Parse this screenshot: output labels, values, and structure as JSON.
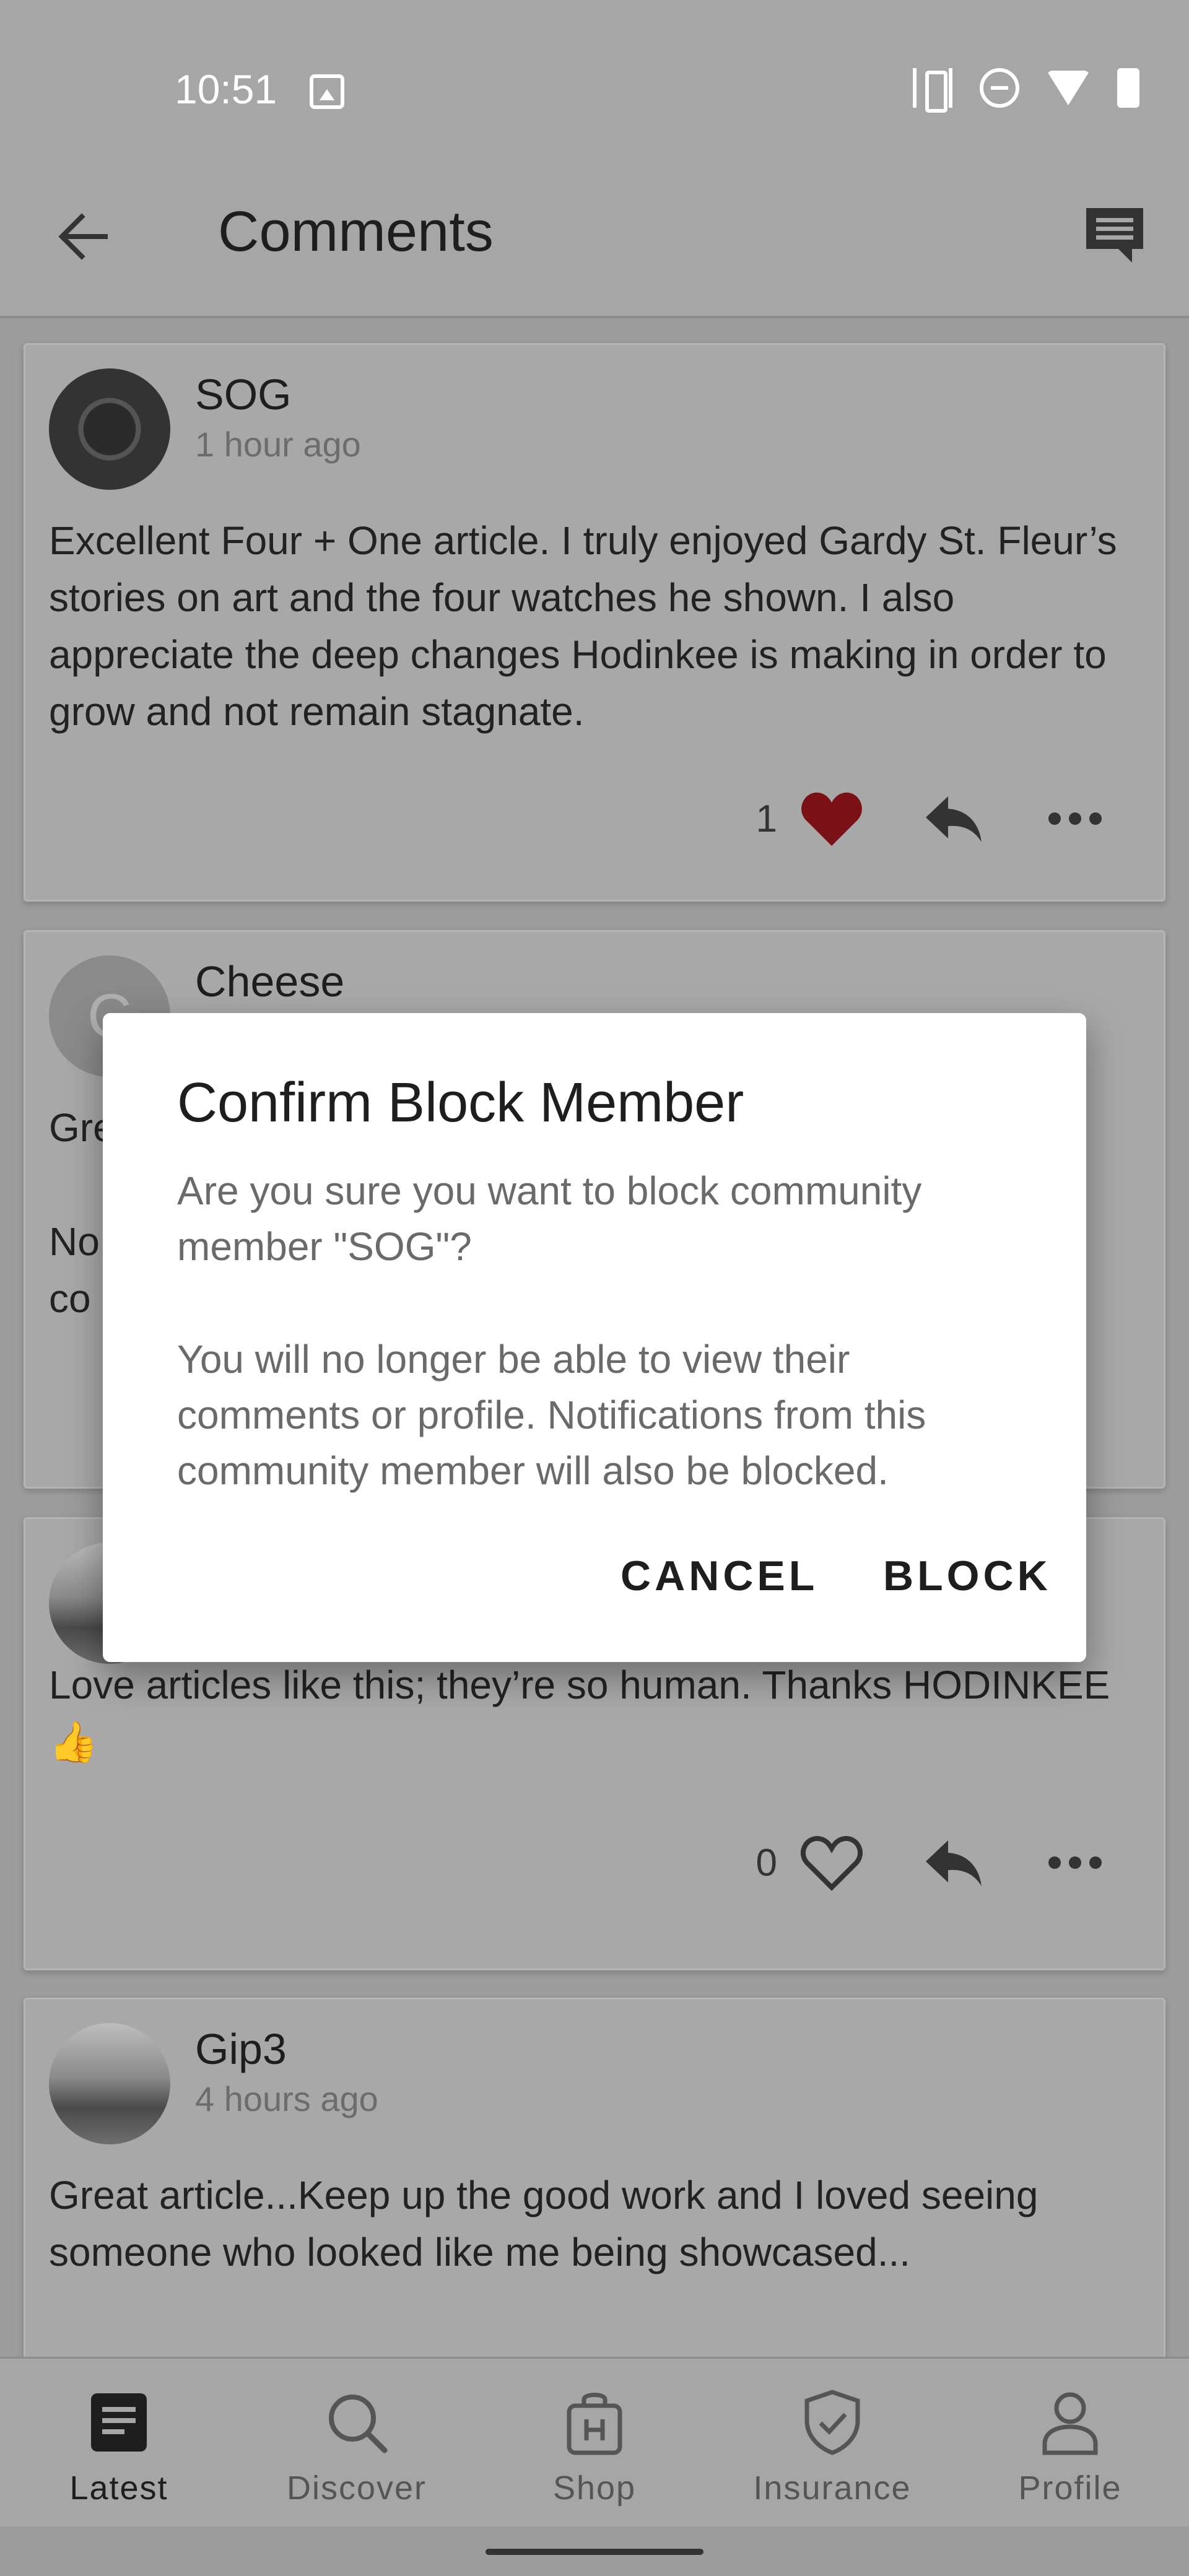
{
  "status_bar": {
    "time": "10:51"
  },
  "app_bar": {
    "title": "Comments"
  },
  "comments": [
    {
      "author": "SOG",
      "time_ago": "1 hour ago",
      "text": "Excellent Four + One article.  I truly enjoyed Gardy St. Fleur’s stories on art and the four watches he shown.  I also appreciate the deep changes Hodinkee is making in order to grow and not remain stagnate.",
      "likes": "1",
      "liked": true
    },
    {
      "author": "Cheese",
      "avatar_letter": "C",
      "time_ago": "",
      "text_lines": [
        "Gre",
        "",
        "No",
        "co"
      ]
    },
    {
      "text": "Love articles like this; they’re so human. Thanks HODINKEE 👍",
      "likes": "0",
      "liked": false
    },
    {
      "author": "Gip3",
      "time_ago": "4 hours ago",
      "text": "Great article...Keep up the good work and I loved seeing someone who looked like me being showcased..."
    }
  ],
  "dialog": {
    "title": "Confirm Block Member",
    "message_1": "Are you sure you want to block community member \"SOG\"?",
    "message_2": "You will no longer be able to view their comments or profile. Notifications from this community member will also be blocked.",
    "cancel_label": "CANCEL",
    "block_label": "BLOCK"
  },
  "bottom_nav": {
    "items": [
      {
        "label": "Latest",
        "icon": "latest-icon",
        "active": true
      },
      {
        "label": "Discover",
        "icon": "search-icon"
      },
      {
        "label": "Shop",
        "icon": "shopping-bag-icon"
      },
      {
        "label": "Insurance",
        "icon": "shield-icon"
      },
      {
        "label": "Profile",
        "icon": "person-icon"
      }
    ]
  },
  "colors": {
    "heart_liked": "#7a1117",
    "scrim": "#9c9c9c",
    "dialog_bg": "#ffffff"
  }
}
